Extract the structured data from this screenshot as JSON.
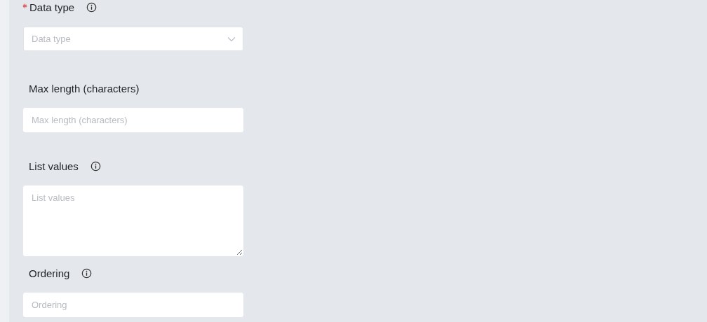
{
  "fields": [
    {
      "kind": "select",
      "label": "Data type",
      "required": true,
      "info": true,
      "placeholder": "Data type"
    },
    {
      "kind": "input",
      "label": "Max length (characters)",
      "required": false,
      "info": false,
      "placeholder": "Max length (characters)"
    },
    {
      "kind": "textarea",
      "label": "List values",
      "required": false,
      "info": true,
      "placeholder": "List values"
    },
    {
      "kind": "input",
      "label": "Ordering",
      "required": false,
      "info": true,
      "placeholder": "Ordering"
    }
  ]
}
